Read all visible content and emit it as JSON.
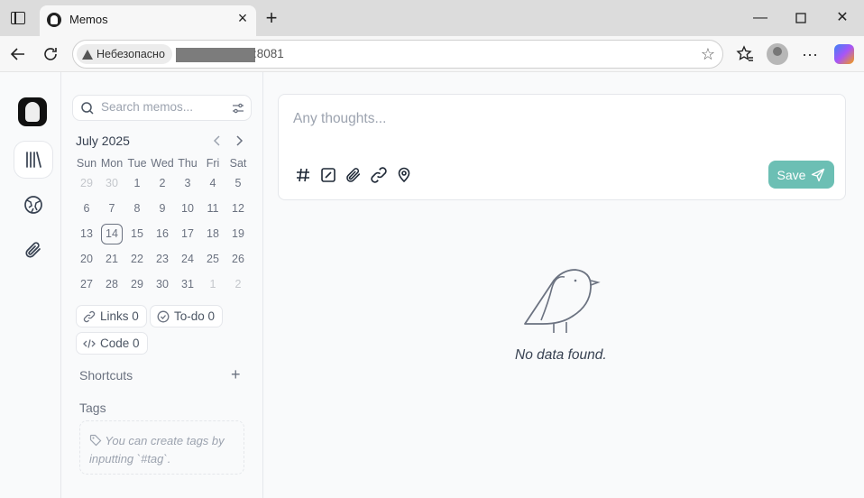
{
  "browser": {
    "tab_title": "Memos",
    "address_security_label": "Небезопасно",
    "address_port": ":8081"
  },
  "search": {
    "placeholder": "Search memos..."
  },
  "calendar": {
    "month_label": "July 2025",
    "weekdays": [
      "Sun",
      "Mon",
      "Tue",
      "Wed",
      "Thu",
      "Fri",
      "Sat"
    ],
    "weeks": [
      [
        "29",
        "30",
        "1",
        "2",
        "3",
        "4",
        "5"
      ],
      [
        "6",
        "7",
        "8",
        "9",
        "10",
        "11",
        "12"
      ],
      [
        "13",
        "14",
        "15",
        "16",
        "17",
        "18",
        "19"
      ],
      [
        "20",
        "21",
        "22",
        "23",
        "24",
        "25",
        "26"
      ],
      [
        "27",
        "28",
        "29",
        "30",
        "31",
        "1",
        "2"
      ]
    ],
    "today": "14"
  },
  "stats": {
    "links_label": "Links 0",
    "todo_label": "To-do 0",
    "code_label": "Code 0"
  },
  "shortcuts": {
    "title": "Shortcuts"
  },
  "tags": {
    "title": "Tags",
    "empty_line1": "You can create tags by",
    "empty_line2": "inputting `#tag`."
  },
  "editor": {
    "placeholder": "Any thoughts...",
    "save_label": "Save"
  },
  "empty_state": {
    "text": "No data found."
  },
  "colors": {
    "accent": "#6cbfb4",
    "border": "#e5e7eb",
    "muted_text": "#9ca3af"
  }
}
